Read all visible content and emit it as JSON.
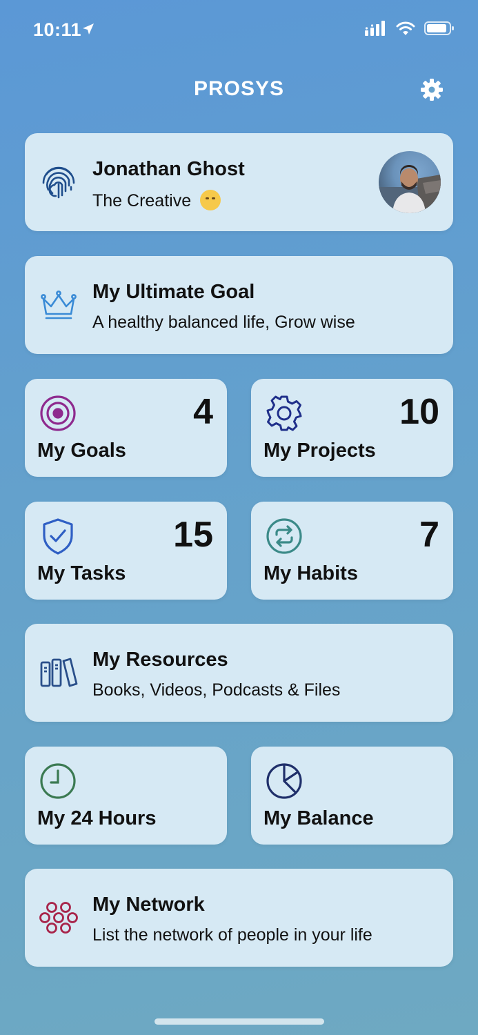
{
  "status_bar": {
    "time": "10:11"
  },
  "header": {
    "title": "PROSYS"
  },
  "profile": {
    "name": "Jonathan Ghost",
    "subtitle": "The Creative"
  },
  "ultimate_goal": {
    "title": "My Ultimate Goal",
    "subtitle": "A healthy balanced life, Grow wise"
  },
  "tiles": {
    "goals": {
      "label": "My Goals",
      "count": "4"
    },
    "projects": {
      "label": "My Projects",
      "count": "10"
    },
    "tasks": {
      "label": "My Tasks",
      "count": "15"
    },
    "habits": {
      "label": "My Habits",
      "count": "7"
    },
    "hours": {
      "label": "My 24 Hours"
    },
    "balance": {
      "label": "My Balance"
    }
  },
  "resources": {
    "title": "My Resources",
    "subtitle": "Books, Videos, Podcasts & Files"
  },
  "network": {
    "title": "My Network",
    "subtitle": "List the network of people in your life"
  },
  "colors": {
    "fingerprint": "#1f4e8c",
    "crown": "#3a8bd6",
    "goals": "#8e2a8e",
    "projects": "#1f2f8a",
    "tasks": "#2f5fc4",
    "habits": "#3b8a88",
    "resources": "#2a4f8a",
    "hours": "#3b7a52",
    "balance": "#1f2f6a",
    "network": "#a8244a"
  }
}
